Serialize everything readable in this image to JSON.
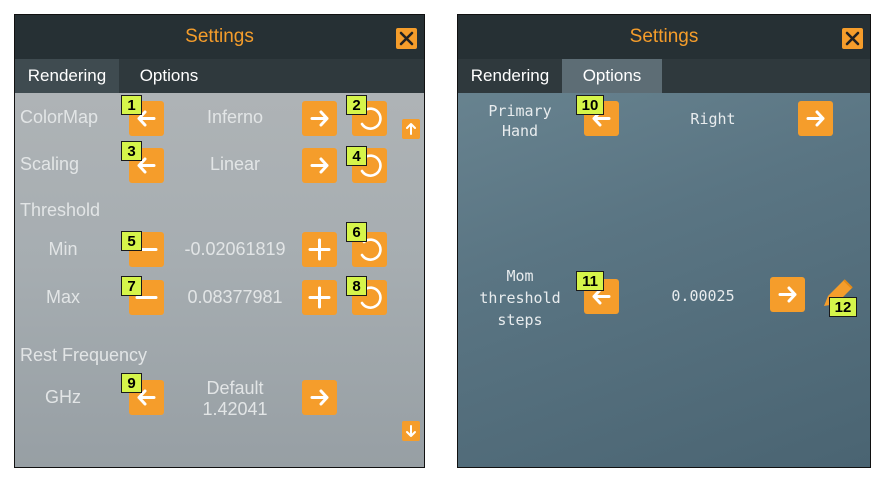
{
  "left_panel": {
    "title": "Settings",
    "tabs": [
      {
        "label": "Rendering"
      },
      {
        "label": "Options"
      }
    ],
    "colormap": {
      "label": "ColorMap",
      "value": "Inferno"
    },
    "scaling": {
      "label": "Scaling",
      "value": "Linear"
    },
    "threshold": {
      "heading": "Threshold",
      "min_label": "Min",
      "min_value": "-0.02061819",
      "max_label": "Max",
      "max_value": "0.08377981"
    },
    "rest_frequency": {
      "heading": "Rest Frequency",
      "unit": "GHz",
      "value_line1": "Default",
      "value_line2": "1.42041"
    }
  },
  "right_panel": {
    "title": "Settings",
    "tabs": [
      {
        "label": "Rendering"
      },
      {
        "label": "Options"
      }
    ],
    "primary_hand": {
      "label_line1": "Primary",
      "label_line2": "Hand",
      "value": "Right"
    },
    "mom_threshold": {
      "label_line1": "Mom",
      "label_line2": "threshold",
      "label_line3": "steps",
      "value": "0.00025"
    }
  },
  "markers": [
    "1",
    "2",
    "3",
    "4",
    "5",
    "6",
    "7",
    "8",
    "9",
    "10",
    "11",
    "12"
  ],
  "colors": {
    "accent": "#f59d2b",
    "titlebar": "#263034",
    "marker": "#d6f54a"
  }
}
